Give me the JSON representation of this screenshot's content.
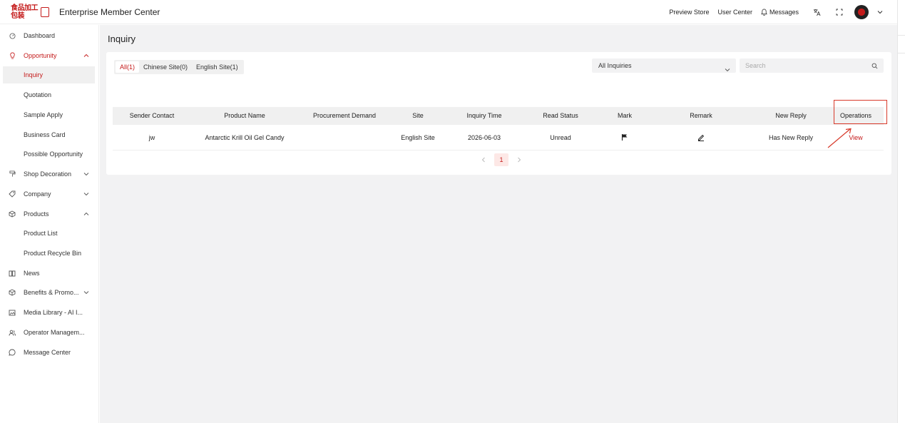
{
  "header": {
    "logo_text": "食品加工包装",
    "app_title": "Enterprise Member Center",
    "links": {
      "preview_store": "Preview Store",
      "user_center": "User Center",
      "messages": "Messages"
    },
    "icons": [
      "translate-icon",
      "fullscreen-icon",
      "avatar",
      "chevron-down-icon"
    ]
  },
  "sidebar": {
    "items": [
      {
        "label": "Dashboard",
        "icon": "dashboard-icon"
      },
      {
        "label": "Opportunity",
        "icon": "lightbulb-icon",
        "expanded": true
      },
      {
        "label": "Inquiry",
        "selected": true
      },
      {
        "label": "Quotation"
      },
      {
        "label": "Sample Apply"
      },
      {
        "label": "Business Card"
      },
      {
        "label": "Possible Opportunity"
      },
      {
        "label": "Shop Decoration",
        "icon": "paint-roller-icon",
        "expanded": false
      },
      {
        "label": "Company",
        "icon": "tag-icon",
        "expanded": false
      },
      {
        "label": "Products",
        "icon": "cube-icon",
        "expanded": true
      },
      {
        "label": "Product List"
      },
      {
        "label": "Product Recycle Bin"
      },
      {
        "label": "News",
        "icon": "news-icon"
      },
      {
        "label": "Benefits & Promo...",
        "icon": "cube-icon",
        "expanded": false
      },
      {
        "label": "Media Library - AI I...",
        "icon": "image-icon"
      },
      {
        "label": "Operator Managem...",
        "icon": "users-icon"
      },
      {
        "label": "Message Center",
        "icon": "chat-icon"
      }
    ]
  },
  "main": {
    "page_title": "Inquiry",
    "tabs": [
      {
        "label": "All(1)",
        "active": true
      },
      {
        "label": "Chinese Site(0)"
      },
      {
        "label": "English Site(1)"
      }
    ],
    "filter_select": {
      "value": "All Inquiries"
    },
    "search": {
      "placeholder": "Search"
    },
    "table": {
      "columns": [
        "Sender Contact",
        "Product Name",
        "Procurement Demand",
        "Site",
        "Inquiry Time",
        "Read Status",
        "Mark",
        "Remark",
        "New Reply",
        "Operations"
      ],
      "rows": [
        {
          "sender_contact": "jw",
          "product_name": "Antarctic Krill Oil Gel Candy",
          "procurement_demand": "",
          "site": "English Site",
          "inquiry_time": "2026-06-03",
          "read_status": "Unread",
          "mark": "flag-icon",
          "remark": "edit-icon",
          "new_reply": "Has New Reply",
          "operation": "View"
        }
      ]
    },
    "pagination": {
      "current": "1"
    }
  },
  "colors": {
    "accent": "#c41a1a",
    "content_bg": "#f2f2f3",
    "annotation": "#d83a2b"
  }
}
